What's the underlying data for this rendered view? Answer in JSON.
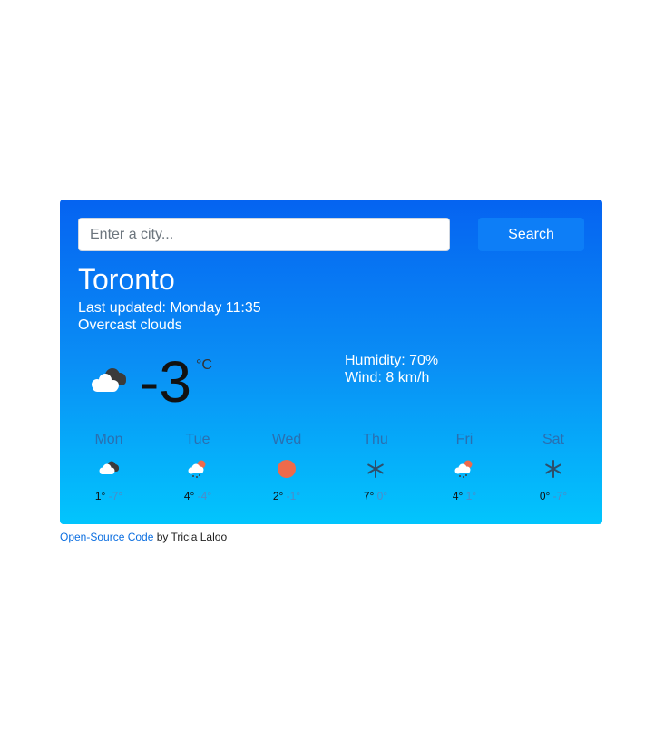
{
  "search": {
    "placeholder": "Enter a city...",
    "value": "",
    "button_label": "Search"
  },
  "current": {
    "city": "Toronto",
    "last_updated": "Last updated: Monday 11:35",
    "description": "Overcast clouds",
    "icon": "overcast-clouds-icon",
    "temperature": "-3",
    "unit": "°C",
    "humidity": "Humidity: 70%",
    "wind": "Wind: 8 km/h"
  },
  "forecast": [
    {
      "day": "Mon",
      "icon": "cloudy-icon",
      "max": "1°",
      "min": "-7°"
    },
    {
      "day": "Tue",
      "icon": "snow-sun-cloud-icon",
      "max": "4°",
      "min": "-4°"
    },
    {
      "day": "Wed",
      "icon": "sun-icon",
      "max": "2°",
      "min": "-1°"
    },
    {
      "day": "Thu",
      "icon": "snowflake-icon",
      "max": "7°",
      "min": "0°"
    },
    {
      "day": "Fri",
      "icon": "snow-sun-cloud-icon",
      "max": "4°",
      "min": "1°"
    },
    {
      "day": "Sat",
      "icon": "snowflake-icon",
      "max": "0°",
      "min": "-7°"
    }
  ],
  "footer": {
    "link_text": "Open-Source Code",
    "suffix": " by Tricia Laloo"
  },
  "colors": {
    "gradient_top": "#0563f1",
    "gradient_bottom": "#02c5fd",
    "sun": "#ee6a4b",
    "button": "#0d7ef7"
  }
}
